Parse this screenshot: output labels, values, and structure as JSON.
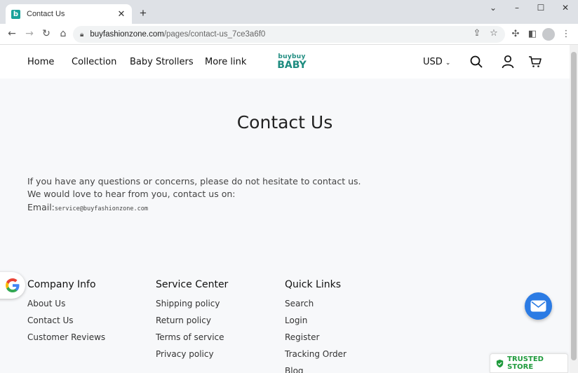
{
  "browser": {
    "tab_title": "Contact Us",
    "tab_favicon_letter": "b",
    "tab_close": "✕",
    "new_tab": "+",
    "url_host": "buyfashionzone.com",
    "url_path": "/pages/contact-us_7ce3a6f0"
  },
  "header": {
    "nav": [
      "Home",
      "Collection",
      "Baby Strollers",
      "More link"
    ],
    "logo_top": "buybuy",
    "logo_bottom": "BABY",
    "currency": "USD"
  },
  "main": {
    "title": "Contact Us",
    "line1": "If you have any questions or concerns, please do not hesitate to contact us.",
    "line2": "We would love to hear from you, contact us on:",
    "email_label": "Email:",
    "email_value": "service@buyfashionzone.com"
  },
  "footer": {
    "columns": [
      {
        "heading": "Company Info",
        "links": [
          "About Us",
          "Contact Us",
          "Customer Reviews"
        ]
      },
      {
        "heading": "Service Center",
        "links": [
          "Shipping policy",
          "Return policy",
          "Terms of service",
          "Privacy policy"
        ]
      },
      {
        "heading": "Quick Links",
        "links": [
          "Search",
          "Login",
          "Register",
          "Tracking Order",
          "Blog"
        ]
      }
    ]
  },
  "badges": {
    "trusted_store": "TRUSTED STORE"
  },
  "colors": {
    "brand_teal": "#1e8c80",
    "chat_blue": "#2b7be4",
    "trusted_green": "#1f9a3c"
  }
}
